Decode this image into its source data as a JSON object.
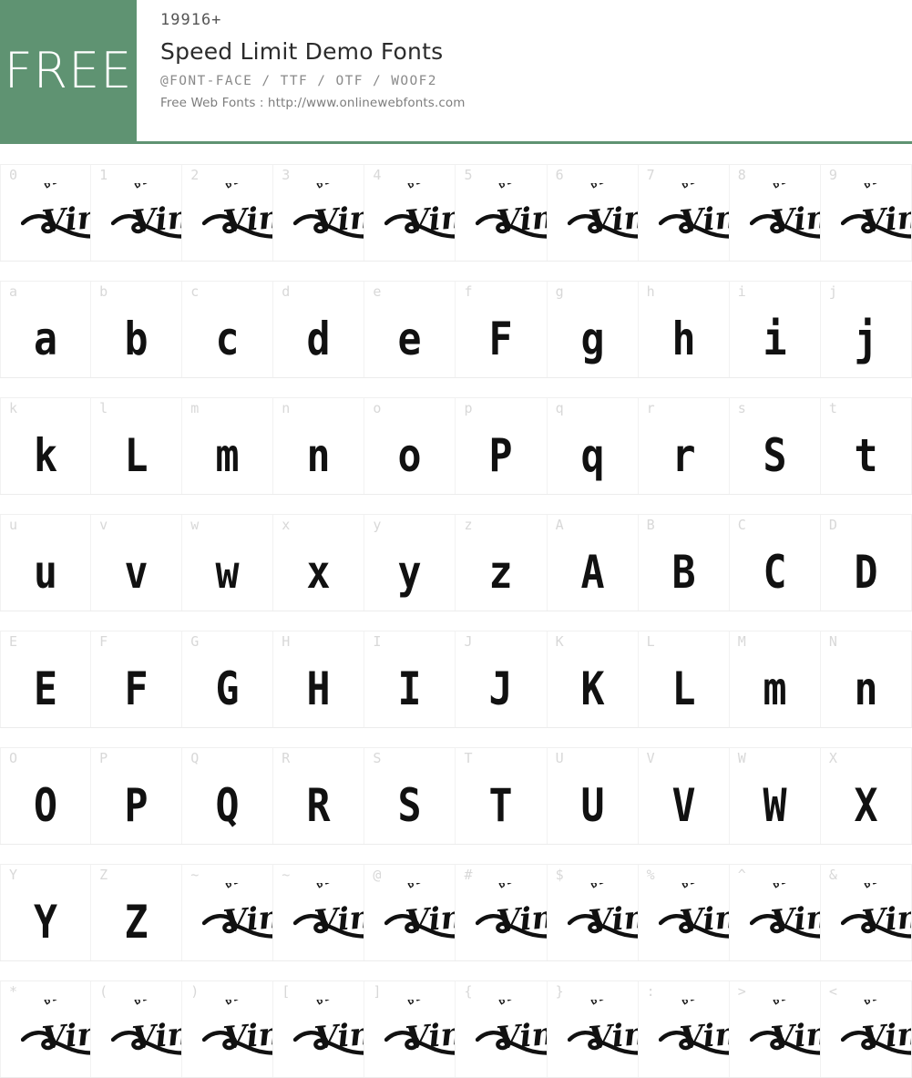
{
  "header": {
    "free_badge": "FREE",
    "count": "19916+",
    "title": "Speed Limit Demo Fonts",
    "formats": "@FONT-FACE / TTF / OTF / WOOF2",
    "source": "Free Web Fonts : http://www.onlinewebfonts.com",
    "accent_color": "#5f9372",
    "badge_text_color": "#ffffff"
  },
  "grid": {
    "columns": 10,
    "label_color": "#d8d8d8",
    "glyph_color": "#111111",
    "placeholder_logo": {
      "arc_text": "DEMO FONT",
      "script_text": "Vinty"
    },
    "rows": [
      {
        "cells": [
          {
            "label": "0",
            "glyph": "",
            "kind": "logo"
          },
          {
            "label": "1",
            "glyph": "",
            "kind": "logo"
          },
          {
            "label": "2",
            "glyph": "",
            "kind": "logo"
          },
          {
            "label": "3",
            "glyph": "",
            "kind": "logo"
          },
          {
            "label": "4",
            "glyph": "",
            "kind": "logo"
          },
          {
            "label": "5",
            "glyph": "",
            "kind": "logo"
          },
          {
            "label": "6",
            "glyph": "",
            "kind": "logo"
          },
          {
            "label": "7",
            "glyph": "",
            "kind": "logo"
          },
          {
            "label": "8",
            "glyph": "",
            "kind": "logo"
          },
          {
            "label": "9",
            "glyph": "",
            "kind": "logo"
          }
        ]
      },
      {
        "cells": [
          {
            "label": "a",
            "glyph": "a",
            "kind": "letter"
          },
          {
            "label": "b",
            "glyph": "b",
            "kind": "letter"
          },
          {
            "label": "c",
            "glyph": "c",
            "kind": "letter"
          },
          {
            "label": "d",
            "glyph": "d",
            "kind": "letter"
          },
          {
            "label": "e",
            "glyph": "e",
            "kind": "letter"
          },
          {
            "label": "f",
            "glyph": "F",
            "kind": "letter"
          },
          {
            "label": "g",
            "glyph": "g",
            "kind": "letter"
          },
          {
            "label": "h",
            "glyph": "h",
            "kind": "letter"
          },
          {
            "label": "i",
            "glyph": "i",
            "kind": "letter"
          },
          {
            "label": "j",
            "glyph": "j",
            "kind": "letter"
          }
        ]
      },
      {
        "cells": [
          {
            "label": "k",
            "glyph": "k",
            "kind": "letter"
          },
          {
            "label": "l",
            "glyph": "L",
            "kind": "letter"
          },
          {
            "label": "m",
            "glyph": "m",
            "kind": "letter"
          },
          {
            "label": "n",
            "glyph": "n",
            "kind": "letter"
          },
          {
            "label": "o",
            "glyph": "o",
            "kind": "letter"
          },
          {
            "label": "p",
            "glyph": "P",
            "kind": "letter"
          },
          {
            "label": "q",
            "glyph": "q",
            "kind": "letter"
          },
          {
            "label": "r",
            "glyph": "r",
            "kind": "letter"
          },
          {
            "label": "s",
            "glyph": "S",
            "kind": "letter"
          },
          {
            "label": "t",
            "glyph": "t",
            "kind": "letter"
          }
        ]
      },
      {
        "cells": [
          {
            "label": "u",
            "glyph": "u",
            "kind": "letter"
          },
          {
            "label": "v",
            "glyph": "v",
            "kind": "letter"
          },
          {
            "label": "w",
            "glyph": "w",
            "kind": "letter"
          },
          {
            "label": "x",
            "glyph": "x",
            "kind": "letter"
          },
          {
            "label": "y",
            "glyph": "y",
            "kind": "letter"
          },
          {
            "label": "z",
            "glyph": "z",
            "kind": "letter"
          },
          {
            "label": "A",
            "glyph": "A",
            "kind": "letter"
          },
          {
            "label": "B",
            "glyph": "B",
            "kind": "letter"
          },
          {
            "label": "C",
            "glyph": "C",
            "kind": "letter"
          },
          {
            "label": "D",
            "glyph": "D",
            "kind": "letter"
          }
        ]
      },
      {
        "cells": [
          {
            "label": "E",
            "glyph": "E",
            "kind": "letter"
          },
          {
            "label": "F",
            "glyph": "F",
            "kind": "letter"
          },
          {
            "label": "G",
            "glyph": "G",
            "kind": "letter"
          },
          {
            "label": "H",
            "glyph": "H",
            "kind": "letter"
          },
          {
            "label": "I",
            "glyph": "I",
            "kind": "letter"
          },
          {
            "label": "J",
            "glyph": "J",
            "kind": "letter"
          },
          {
            "label": "K",
            "glyph": "K",
            "kind": "letter"
          },
          {
            "label": "L",
            "glyph": "L",
            "kind": "letter"
          },
          {
            "label": "M",
            "glyph": "m",
            "kind": "letter"
          },
          {
            "label": "N",
            "glyph": "n",
            "kind": "letter"
          }
        ]
      },
      {
        "cells": [
          {
            "label": "O",
            "glyph": "O",
            "kind": "letter"
          },
          {
            "label": "P",
            "glyph": "P",
            "kind": "letter"
          },
          {
            "label": "Q",
            "glyph": "Q",
            "kind": "letter"
          },
          {
            "label": "R",
            "glyph": "R",
            "kind": "letter"
          },
          {
            "label": "S",
            "glyph": "S",
            "kind": "letter"
          },
          {
            "label": "T",
            "glyph": "T",
            "kind": "letter"
          },
          {
            "label": "U",
            "glyph": "U",
            "kind": "letter"
          },
          {
            "label": "V",
            "glyph": "V",
            "kind": "letter"
          },
          {
            "label": "W",
            "glyph": "W",
            "kind": "letter"
          },
          {
            "label": "X",
            "glyph": "X",
            "kind": "letter"
          }
        ]
      },
      {
        "cells": [
          {
            "label": "Y",
            "glyph": "Y",
            "kind": "letter"
          },
          {
            "label": "Z",
            "glyph": "Z",
            "kind": "letter"
          },
          {
            "label": "~",
            "glyph": "",
            "kind": "logo"
          },
          {
            "label": "~",
            "glyph": "",
            "kind": "logo"
          },
          {
            "label": "@",
            "glyph": "",
            "kind": "logo"
          },
          {
            "label": "#",
            "glyph": "",
            "kind": "logo"
          },
          {
            "label": "$",
            "glyph": "",
            "kind": "logo"
          },
          {
            "label": "%",
            "glyph": "",
            "kind": "logo"
          },
          {
            "label": "^",
            "glyph": "",
            "kind": "logo"
          },
          {
            "label": "&",
            "glyph": "",
            "kind": "logo"
          }
        ]
      },
      {
        "cells": [
          {
            "label": "*",
            "glyph": "",
            "kind": "logo"
          },
          {
            "label": "(",
            "glyph": "",
            "kind": "logo"
          },
          {
            "label": ")",
            "glyph": "",
            "kind": "logo"
          },
          {
            "label": "[",
            "glyph": "",
            "kind": "logo"
          },
          {
            "label": "]",
            "glyph": "",
            "kind": "logo"
          },
          {
            "label": "{",
            "glyph": "",
            "kind": "logo"
          },
          {
            "label": "}",
            "glyph": "",
            "kind": "logo"
          },
          {
            "label": ":",
            "glyph": "",
            "kind": "logo"
          },
          {
            "label": ">",
            "glyph": "",
            "kind": "logo"
          },
          {
            "label": "<",
            "glyph": "",
            "kind": "logo"
          }
        ]
      }
    ]
  }
}
